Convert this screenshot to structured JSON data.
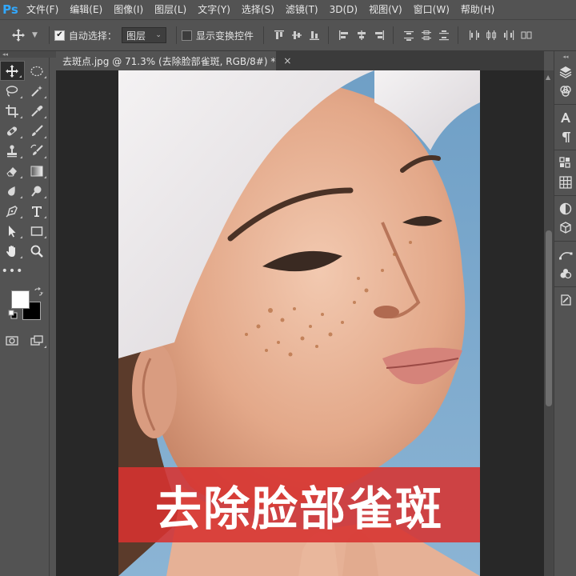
{
  "app": {
    "logo": "Ps",
    "menu": [
      "文件(F)",
      "编辑(E)",
      "图像(I)",
      "图层(L)",
      "文字(Y)",
      "选择(S)",
      "滤镜(T)",
      "3D(D)",
      "视图(V)",
      "窗口(W)",
      "帮助(H)"
    ]
  },
  "options": {
    "auto_select_label": "自动选择：",
    "auto_select_checked": true,
    "auto_select_target": "图层",
    "show_transform_label": "显示变换控件",
    "show_transform_checked": false
  },
  "document": {
    "tab_title": "去斑点.jpg @ 71.3% (去除脸部雀斑, RGB/8#) *",
    "close_glyph": "×"
  },
  "image": {
    "banner_text": "去除脸部雀斑",
    "banner_color": "#d73230"
  },
  "colors": {
    "foreground": "#ffffff",
    "background": "#000000",
    "accent": "#31a8ff"
  },
  "tools": {
    "more_glyph": "•••"
  },
  "panel_collapse_glyph": "◂◂"
}
